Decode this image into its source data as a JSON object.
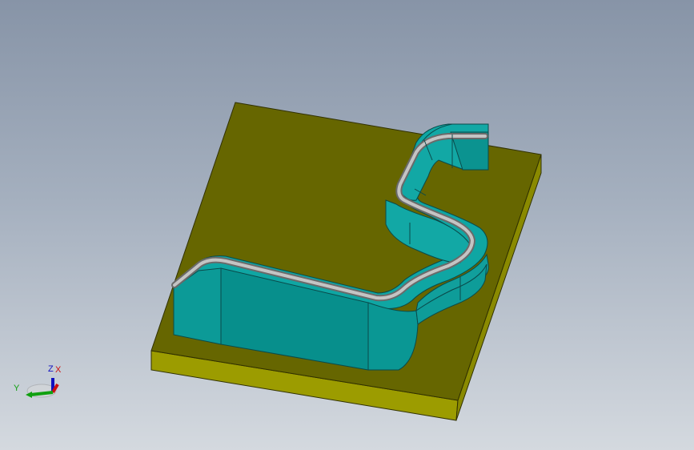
{
  "viewport": {
    "background_top": "#8794a7",
    "background_bottom": "#d4d9df"
  },
  "model": {
    "base_plate_color": "#666600",
    "base_side_color": "#a0a000",
    "wall_color": "#10a3a0",
    "wall_dark_color": "#089090",
    "bead_color": "#b8b8b8"
  },
  "triad": {
    "z_label": "Z",
    "x_label": "X",
    "y_label": "Y",
    "x_color": "#cc1010",
    "y_color": "#10a010",
    "z_color": "#1010c0"
  }
}
